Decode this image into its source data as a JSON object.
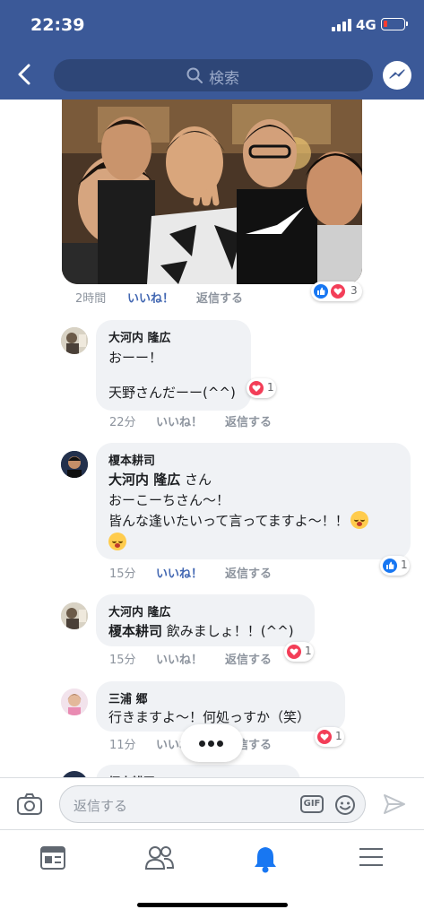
{
  "status_bar": {
    "time": "22:39",
    "network": "4G"
  },
  "nav": {
    "search_placeholder": "検索"
  },
  "post": {
    "timestamp": "2時間",
    "like_label": "いいね！",
    "reply_label": "返信する",
    "reaction_count": "3"
  },
  "comments": [
    {
      "name": "大河内 隆広",
      "lines": [
        "おーー！",
        "",
        "天野さんだーー(^^)"
      ],
      "time": "22分",
      "like_label": "いいね！",
      "reply_label": "返信する",
      "reaction_count": "1",
      "reaction": "heart",
      "liked": false
    },
    {
      "name": "榎本耕司",
      "mention": "大河内 隆広",
      "mention_suffix": " さん",
      "lines": [
        "おーこーちさん〜！",
        "皆んな逢いたいって言ってますよ〜！！"
      ],
      "time": "15分",
      "like_label": "いいね！",
      "reply_label": "返信する",
      "reaction_count": "1",
      "reaction": "like",
      "liked": true
    },
    {
      "name": "大河内 隆広",
      "mention": "榎本耕司",
      "text": " 飲みましょ！！(^^)",
      "time": "15分",
      "like_label": "いいね！",
      "reply_label": "返信する",
      "reaction_count": "1",
      "reaction": "heart",
      "liked": false
    },
    {
      "name": "三浦 郷",
      "lines": [
        "行きますよ〜！何処っすか（笑）"
      ],
      "time": "11分",
      "like_label": "いいね！",
      "reply_label": "返信する",
      "reaction_count": "1",
      "reaction": "heart",
      "liked": false
    },
    {
      "name": "榎本耕司"
    }
  ],
  "composer": {
    "placeholder": "返信する",
    "gif_label": "GIF"
  },
  "icons": {
    "back": "chevron-left-icon",
    "search": "search-icon",
    "messenger": "messenger-icon",
    "camera": "camera-icon",
    "emoji": "smiley-icon",
    "send": "send-icon",
    "feed": "news-feed-icon",
    "friends": "friends-icon",
    "notifications": "bell-icon",
    "menu": "menu-icon"
  },
  "colors": {
    "brand": "#3b5998",
    "link": "#4267b2",
    "heart": "#f33e58",
    "like": "#1877f2",
    "bubble": "#f0f2f5"
  }
}
